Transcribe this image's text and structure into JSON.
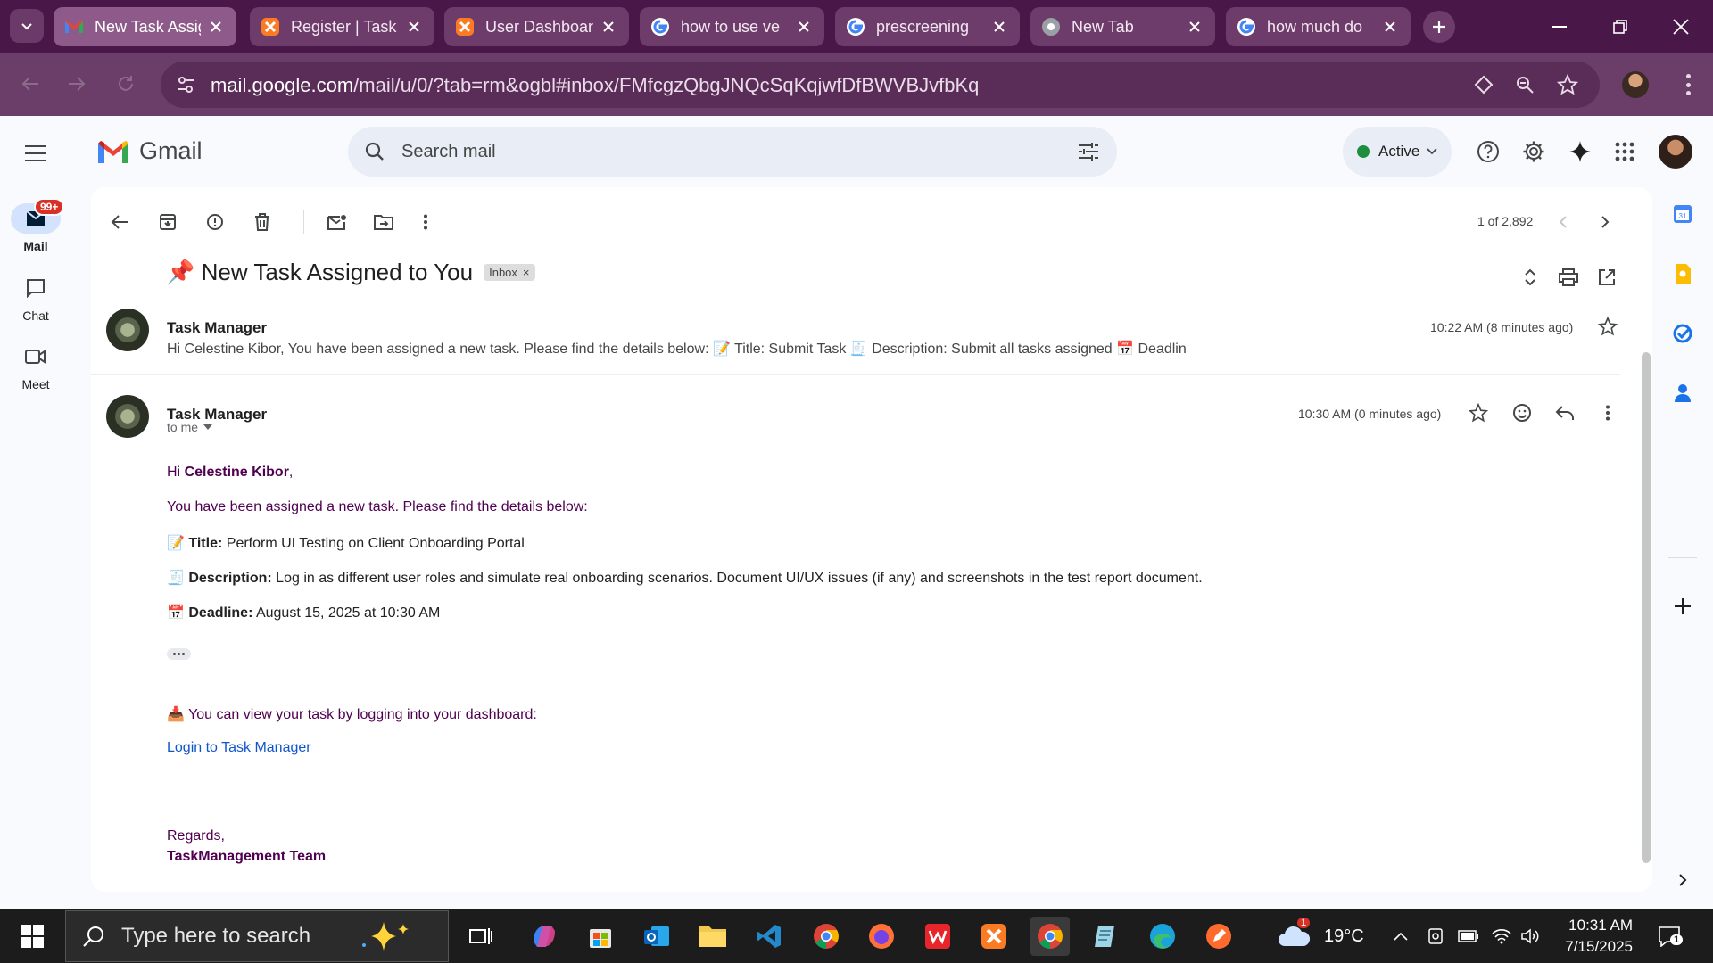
{
  "browser": {
    "tabs": [
      {
        "title": "New Task Assigned to You",
        "icon": "gmail-icon",
        "active": true
      },
      {
        "title": "Register | Task Manager",
        "icon": "xampp-icon"
      },
      {
        "title": "User Dashboard",
        "icon": "xampp-icon"
      },
      {
        "title": "how to use ve",
        "icon": "google-icon"
      },
      {
        "title": "prescreening",
        "icon": "google-icon"
      },
      {
        "title": "New Tab",
        "icon": "chrome-icon"
      },
      {
        "title": "how much do",
        "icon": "google-icon"
      }
    ],
    "url_host": "mail.google.com",
    "url_rest": "/mail/u/0/?tab=rm&ogbl#inbox/FMfcgzQbgJNQcSqKqjwfDfBWVBJvfbKq"
  },
  "gmail": {
    "logo_text": "Gmail",
    "search_placeholder": "Search mail",
    "status": "Active",
    "rail": [
      {
        "label": "Mail",
        "badge": "99+"
      },
      {
        "label": "Chat"
      },
      {
        "label": "Meet"
      }
    ],
    "pager": "1 of 2,892",
    "subject": "📌 New Task Assigned to You",
    "label_tag": "Inbox",
    "messages": [
      {
        "sender": "Task Manager",
        "time": "10:22 AM (8 minutes ago)",
        "snippet": "Hi Celestine Kibor, You have been assigned a new task. Please find the details below: 📝 Title: Submit Task 🧾 Description: Submit all tasks assigned 📅 Deadlin"
      },
      {
        "sender": "Task Manager",
        "time": "10:30 AM (0 minutes ago)",
        "to": "to me",
        "body": {
          "greeting_prefix": "Hi ",
          "greeting_name": "Celestine Kibor",
          "greeting_suffix": ",",
          "intro": "You have been assigned a new task. Please find the details below:",
          "title_icon": "📝",
          "title_label": "Title:",
          "title_value": "Perform UI Testing on Client Onboarding Portal",
          "desc_icon": "🧾",
          "desc_label": "Description:",
          "desc_value": "Log in as different user roles and simulate real onboarding scenarios. Document UI/UX issues (if any) and screenshots in the test report document.",
          "deadline_icon": "📅",
          "deadline_label": "Deadline:",
          "deadline_value": "August 15, 2025 at 10:30 AM",
          "view_text": "📥 You can view your task by logging into your dashboard:",
          "link_text": "Login to Task Manager",
          "regards": "Regards,",
          "team": "TaskManagement Team"
        }
      }
    ]
  },
  "taskbar": {
    "search_placeholder": "Type here to search",
    "weather": "19°C",
    "weather_badge": "1",
    "time": "10:31 AM",
    "date": "7/15/2025",
    "notif_count": "1"
  },
  "colors": {
    "tabbar": "#4a1848",
    "address_bar": "#6b3d69",
    "gmail_bg": "#f8fafd",
    "body_text": "#500050",
    "link": "#1155cc"
  }
}
